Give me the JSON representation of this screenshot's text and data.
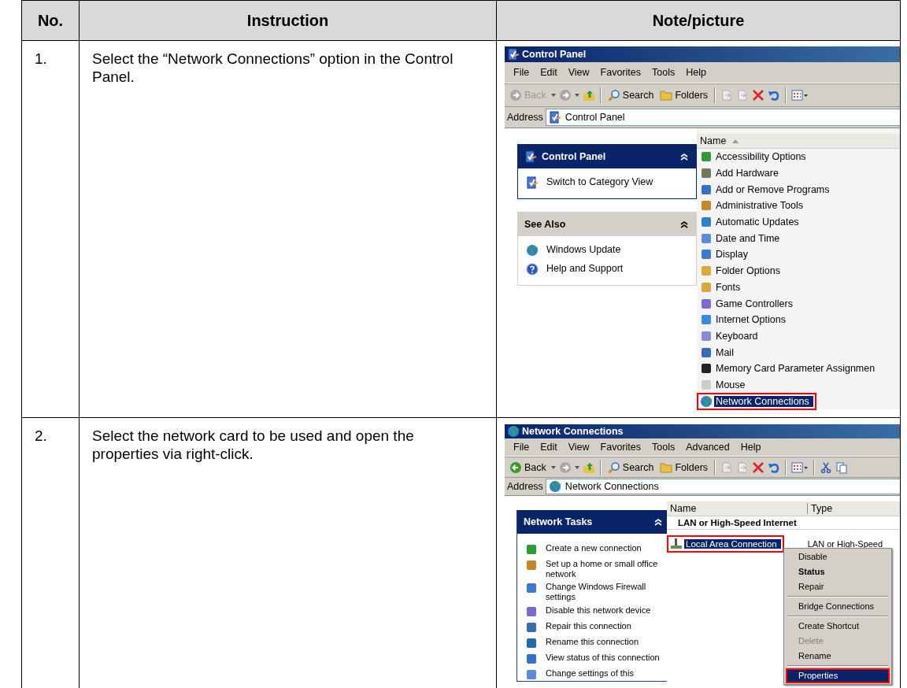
{
  "table": {
    "columns": [
      "No.",
      "Instruction",
      "Note/picture"
    ],
    "rows": [
      {
        "number": "1.",
        "instruction": "Select the “Network Connections” option in the Control Panel.",
        "screenshot": {
          "title": "Control Panel",
          "menu": [
            "File",
            "Edit",
            "View",
            "Favorites",
            "Tools",
            "Help"
          ],
          "toolbar": {
            "back": "Back",
            "back_enabled": false,
            "search": "Search",
            "folders": "Folders",
            "extra_tools": false
          },
          "address_label": "Address",
          "address": "Control Panel",
          "panels": [
            {
              "title": "Control Panel",
              "kind": "primary",
              "expanded": true,
              "items": [
                "Switch to Category View"
              ]
            },
            {
              "title": "See Also",
              "kind": "secondary",
              "expanded": true,
              "items": [
                "Windows Update",
                "Help and Support"
              ]
            }
          ],
          "columns": [
            "Name"
          ],
          "items": [
            {
              "name": "Accessibility Options",
              "selected": false,
              "highlighted": false
            },
            {
              "name": "Add Hardware",
              "selected": false,
              "highlighted": false
            },
            {
              "name": "Add or Remove Programs",
              "selected": false,
              "highlighted": false
            },
            {
              "name": "Administrative Tools",
              "selected": false,
              "highlighted": false
            },
            {
              "name": "Automatic Updates",
              "selected": false,
              "highlighted": false
            },
            {
              "name": "Date and Time",
              "selected": false,
              "highlighted": false
            },
            {
              "name": "Display",
              "selected": false,
              "highlighted": false
            },
            {
              "name": "Folder Options",
              "selected": false,
              "highlighted": false
            },
            {
              "name": "Fonts",
              "selected": false,
              "highlighted": false
            },
            {
              "name": "Game Controllers",
              "selected": false,
              "highlighted": false
            },
            {
              "name": "Internet Options",
              "selected": false,
              "highlighted": false
            },
            {
              "name": "Keyboard",
              "selected": false,
              "highlighted": false
            },
            {
              "name": "Mail",
              "selected": false,
              "highlighted": false
            },
            {
              "name": "Memory Card Parameter Assignmen",
              "selected": false,
              "highlighted": false
            },
            {
              "name": "Mouse",
              "selected": false,
              "highlighted": false
            },
            {
              "name": "Network Connections",
              "selected": true,
              "highlighted": true
            }
          ]
        }
      },
      {
        "number": "2.",
        "instruction": "Select the network card to be used and open the properties via right-click.",
        "screenshot": {
          "title": "Network Connections",
          "menu": [
            "File",
            "Edit",
            "View",
            "Favorites",
            "Tools",
            "Advanced",
            "Help"
          ],
          "toolbar": {
            "back": "Back",
            "back_enabled": true,
            "search": "Search",
            "folders": "Folders",
            "extra_tools": true
          },
          "address_label": "Address",
          "address": "Network Connections",
          "panels": [
            {
              "title": "Network Tasks",
              "kind": "primary",
              "expanded": true,
              "items": [
                "Create a new connection",
                "Set up a home or small office network",
                "Change Windows Firewall settings",
                "Disable this network device",
                "Repair this connection",
                "Rename this connection",
                "View status of this connection",
                "Change settings of this"
              ]
            }
          ],
          "columns": [
            "Name",
            "Type"
          ],
          "group": "LAN or High-Speed Internet",
          "items": [
            {
              "name": "Local Area Connection",
              "type": "LAN or High-Speed",
              "selected": true,
              "highlighted": true
            }
          ],
          "context_menu": [
            {
              "kind": "item",
              "label": "Disable",
              "bold": false,
              "disabled": false,
              "selected": false,
              "highlighted": false
            },
            {
              "kind": "item",
              "label": "Status",
              "bold": true,
              "disabled": false,
              "selected": false,
              "highlighted": false
            },
            {
              "kind": "item",
              "label": "Repair",
              "bold": false,
              "disabled": false,
              "selected": false,
              "highlighted": false
            },
            {
              "kind": "separator"
            },
            {
              "kind": "item",
              "label": "Bridge Connections",
              "bold": false,
              "disabled": false,
              "selected": false,
              "highlighted": false
            },
            {
              "kind": "separator"
            },
            {
              "kind": "item",
              "label": "Create Shortcut",
              "bold": false,
              "disabled": false,
              "selected": false,
              "highlighted": false
            },
            {
              "kind": "item",
              "label": "Delete",
              "bold": false,
              "disabled": true,
              "selected": false,
              "highlighted": false
            },
            {
              "kind": "item",
              "label": "Rename",
              "bold": false,
              "disabled": false,
              "selected": false,
              "highlighted": false
            },
            {
              "kind": "separator"
            },
            {
              "kind": "item",
              "label": "Properties",
              "bold": false,
              "disabled": false,
              "selected": true,
              "highlighted": true
            }
          ]
        }
      }
    ]
  }
}
